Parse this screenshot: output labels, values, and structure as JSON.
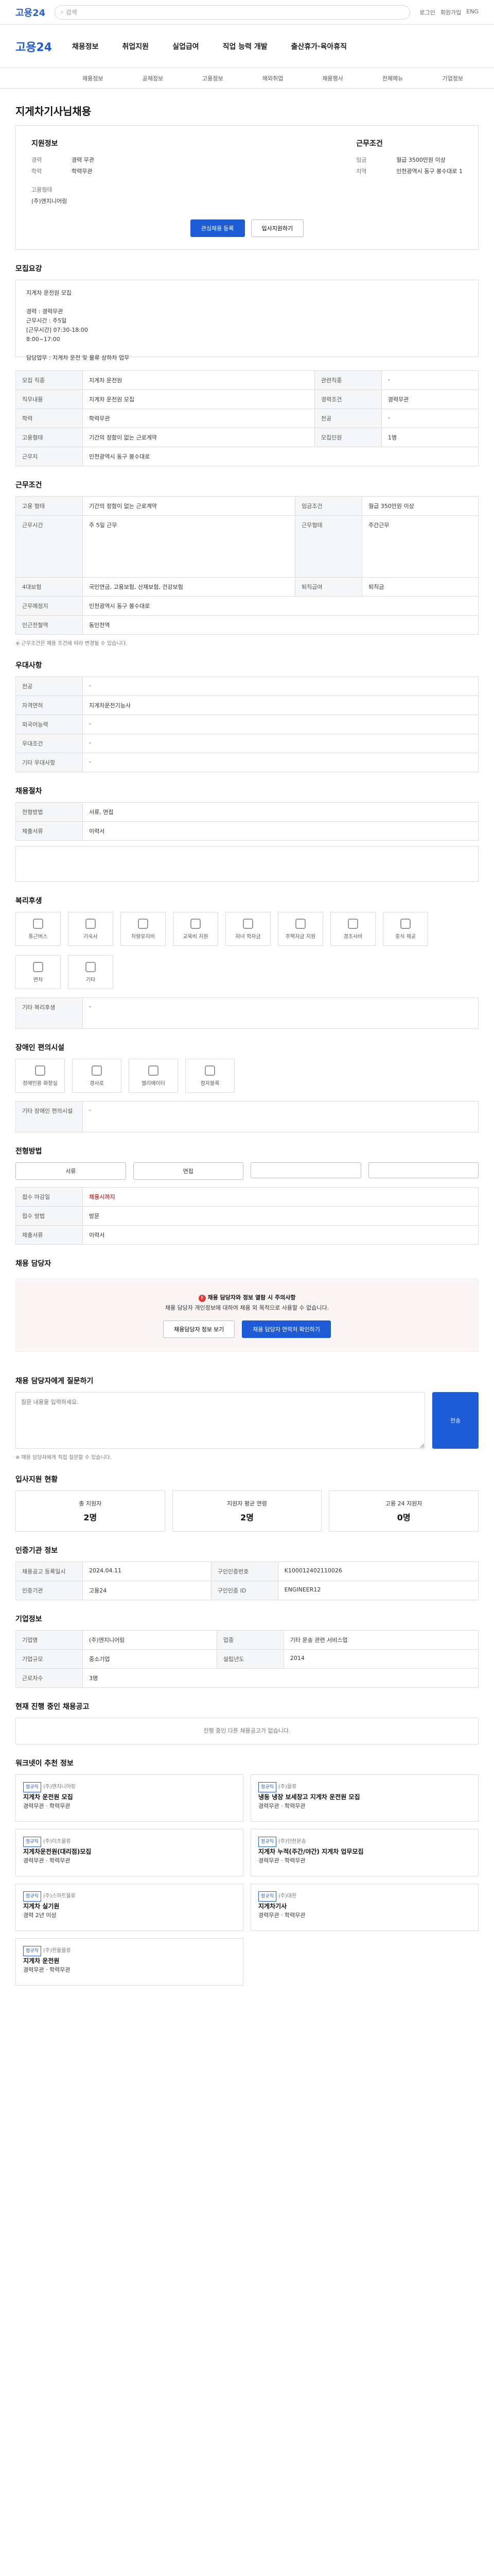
{
  "top": {
    "logo": "고용24",
    "search_placeholder": "검색",
    "links": [
      "로그인",
      "회원가입",
      "ENG"
    ]
  },
  "gnb": {
    "brand": "고용24",
    "menu": [
      "채용정보",
      "취업지원",
      "실업급여",
      "직업 능력 개발",
      "출산휴가·육아휴직"
    ]
  },
  "subnav": [
    "채용정보",
    "공채정보",
    "고용정보",
    "해외취업",
    "채용행사",
    "전체메뉴",
    "기업정보"
  ],
  "title": "지게차기사님채용",
  "hero": {
    "company_label": "지원정보",
    "left": [
      {
        "k": "경력",
        "v": "경력 무관"
      },
      {
        "k": "학력",
        "v": "학력무관"
      }
    ],
    "right_label": "근무조건",
    "right": [
      {
        "k": "임금",
        "v": "월급 3500만원 이상"
      },
      {
        "k": "지역",
        "v": "인천광역시 동구 봉수대로 1"
      }
    ],
    "company": "(주)엔지니어링",
    "job": "지게차 운전원",
    "btn_interest": "관심채용 등록",
    "btn_apply": "입사지원하기"
  },
  "recruit": {
    "title": "모집요강",
    "body": "지게차 운전원 모집\n\n경력 : 경력무관\n근무시간 : 주5일\n[근무시간] 07:30-18:00\n8:00~17:00\n\n담당업무 : 지게차 운전 및 물류 상하차 업무"
  },
  "recruit_table": [
    [
      "모집 직종",
      "지게차 운전원",
      "관련직종",
      "-"
    ],
    [
      "직무내용",
      "지게차 운전원 모집",
      "경력조건",
      "경력무관"
    ],
    [
      "학력",
      "학력무관",
      "전공",
      "-"
    ],
    [
      "고용형태",
      "기간의 정함이 없는 근로계약",
      "모집인원",
      "1명"
    ],
    [
      "근무지",
      "인천광역시 동구 봉수대로",
      "",
      ""
    ]
  ],
  "conditions": {
    "title": "근무조건",
    "rows": [
      [
        "고용 형태",
        "기간의 정함이 없는 근로계약",
        "임금조건",
        "월급 350만원 이상"
      ],
      [
        "근무시간",
        "주 5일 근무",
        "근무형태",
        "주간근무"
      ],
      [
        "4대보험",
        "국민연금, 고용보험, 산재보험, 건강보험",
        "퇴직급여",
        "퇴직금"
      ],
      [
        "근무예정지",
        "인천광역시 동구 봉수대로",
        "",
        ""
      ],
      [
        "인근전철역",
        "동인천역",
        "",
        ""
      ]
    ],
    "note": "※ 근무조건은 채용 조건에 따라 변경될 수 있습니다."
  },
  "prefs": {
    "title": "우대사항",
    "rows": [
      [
        "전공",
        "-"
      ],
      [
        "자격면허",
        "지게차운전기능사"
      ],
      [
        "외국어능력",
        "-"
      ],
      [
        "우대조건",
        "-"
      ],
      [
        "기타 우대사항",
        "-"
      ]
    ]
  },
  "recruit_method": {
    "title": "채용절차",
    "rows": [
      [
        "전형방법",
        "서류, 면접"
      ],
      [
        "제출서류",
        "이력서"
      ]
    ]
  },
  "welfare": {
    "title": "복리후생",
    "items": [
      "통근버스",
      "기숙사",
      "차량유지비",
      "교육비 지원",
      "자녀 학자금",
      "주택자금 지원",
      "경조사비",
      "중식 제공",
      "연차",
      "기타"
    ],
    "extra_label": "기타 복리후생",
    "extra_value": "-"
  },
  "disability": {
    "title": "장애인 편의시설",
    "items": [
      "장애인용 화장실",
      "경사로",
      "엘리베이터",
      "점자블록"
    ],
    "extra_label": "기타 장애인 편의시설",
    "extra_value": "-"
  },
  "apply": {
    "title": "전형방법",
    "tabs": [
      "서류",
      "면접",
      "",
      "",
      ""
    ],
    "rows": [
      [
        "접수 마감일",
        "채용시까지"
      ],
      [
        "접수 방법",
        "방문"
      ],
      [
        "제출서류",
        "이력서"
      ]
    ]
  },
  "manager": {
    "title": "채용 담당자",
    "banner_title": "채용 담당자와 정보 열람 시 주의사항",
    "banner_body": "채용 담당자 개인정보에 대하여 채용 외 목적으로 사용할 수 없습니다.",
    "btn_left": "채용담당자 정보 보기",
    "btn_right": "채용 담당자 연락처 확인하기"
  },
  "ask": {
    "title": "채용 담당자에게 질문하기",
    "placeholder": "질문 내용을 입력하세요.",
    "send": "전송",
    "note": "※ 채용 담당자에게 직접 질문할 수 있습니다."
  },
  "stats": {
    "title": "입사지원 현황",
    "items": [
      {
        "k": "총 지원자",
        "v": "2명"
      },
      {
        "k": "지원자 평균 연령",
        "v": "2명"
      },
      {
        "k": "고용 24 지원자",
        "v": "0명"
      }
    ]
  },
  "info": {
    "title": "인증기관 정보",
    "rows": [
      [
        "채용공고 등록일시",
        "2024.04.11",
        "구인인증번호",
        "K100012402110026"
      ],
      [
        "인증기관",
        "고용24",
        "구인인증 ID",
        "ENGINEER12"
      ]
    ]
  },
  "company": {
    "title": "기업정보",
    "rows": [
      [
        "기업명",
        "(주)엔지니어링",
        "업종",
        "기타 운송 관련 서비스업"
      ],
      [
        "기업규모",
        "중소기업",
        "설립년도",
        "2014"
      ],
      [
        "근로자수",
        "3명",
        "",
        ""
      ]
    ]
  },
  "others": {
    "title": "현재 진행 중인 채용공고",
    "empty": "진행 중인 다른 채용공고가 없습니다."
  },
  "recommend": {
    "title": "워크넷이 추천 정보",
    "cards": [
      {
        "tag": "정규직",
        "co": "(주)엔지니어링",
        "t": "지게차 운전원 모집",
        "d": "경력무관 · 학력무관"
      },
      {
        "tag": "정규직",
        "co": "(주)물류",
        "t": "냉동 냉장 보세창고 지게차 운전원 모집",
        "d": "경력무관 · 학력무관"
      },
      {
        "tag": "정규직",
        "co": "(주)이츠물류",
        "t": "지게차운전원(대리점)모집",
        "d": "경력무관 · 학력무관"
      },
      {
        "tag": "정규직",
        "co": "(주)인천운송",
        "t": "지게차 누적(주간/야간) 지게차 업무모집",
        "d": "경력무관 · 학력무관"
      },
      {
        "tag": "정규직",
        "co": "(주)스마트물류",
        "t": "지게차 실기원",
        "d": "경력 2년 이상"
      },
      {
        "tag": "정규직",
        "co": "(주)대한",
        "t": "지게차기사",
        "d": "경력무관 · 학력무관"
      },
      {
        "tag": "정규직",
        "co": "(주)한울물류",
        "t": "지게차 운전원",
        "d": "경력무관 · 학력무관"
      }
    ]
  }
}
